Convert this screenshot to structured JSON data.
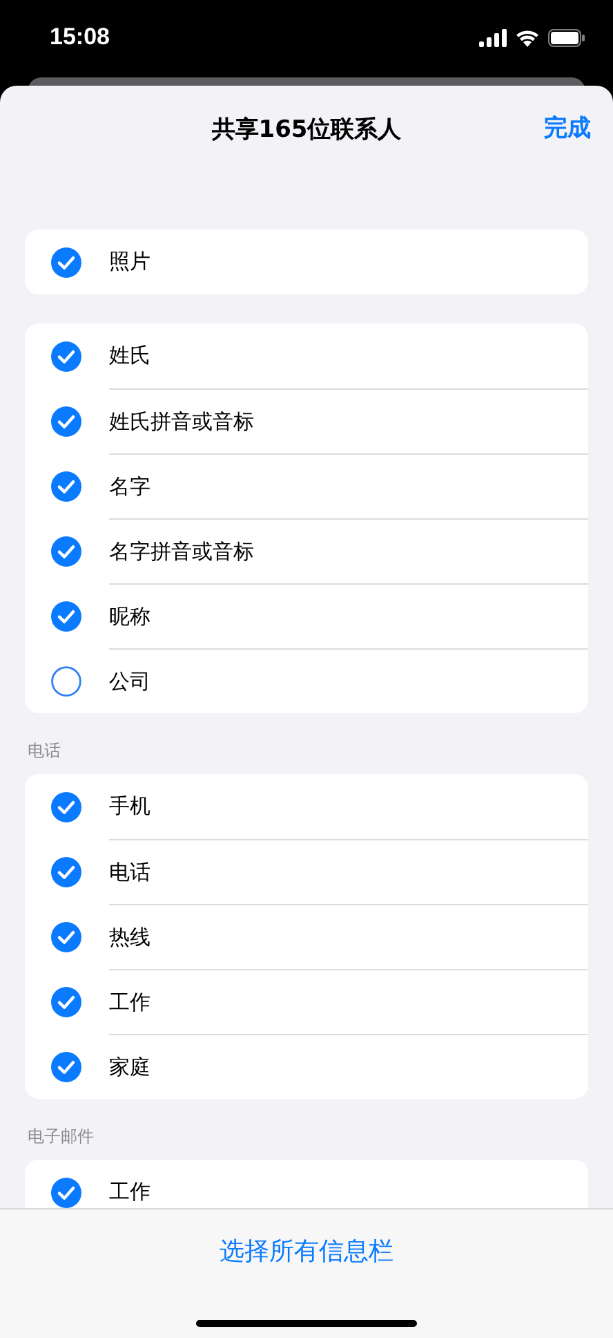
{
  "status_bar": {
    "time": "15:08"
  },
  "header": {
    "title": "共享165位联系人",
    "done": "完成"
  },
  "groups": [
    {
      "items": [
        {
          "label": "照片",
          "checked": true
        }
      ]
    },
    {
      "items": [
        {
          "label": "姓氏",
          "checked": true
        },
        {
          "label": "姓氏拼音或音标",
          "checked": true
        },
        {
          "label": "名字",
          "checked": true
        },
        {
          "label": "名字拼音或音标",
          "checked": true
        },
        {
          "label": "昵称",
          "checked": true
        },
        {
          "label": "公司",
          "checked": false
        }
      ]
    },
    {
      "header": "电话",
      "items": [
        {
          "label": "手机",
          "checked": true
        },
        {
          "label": "电话",
          "checked": true
        },
        {
          "label": "热线",
          "checked": true
        },
        {
          "label": "工作",
          "checked": true
        },
        {
          "label": "家庭",
          "checked": true
        }
      ]
    },
    {
      "header": "电子邮件",
      "items": [
        {
          "label": "工作",
          "checked": true
        }
      ]
    }
  ],
  "footer": {
    "button": "选择所有信息栏"
  }
}
